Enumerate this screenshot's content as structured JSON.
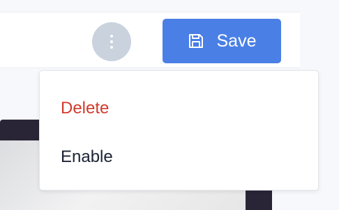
{
  "toolbar": {
    "more_icon": "more-vertical-icon",
    "save_icon": "floppy-disk-icon",
    "save_label": "Save"
  },
  "menu": {
    "items": [
      {
        "label": "Delete",
        "color": "#d23b2c"
      },
      {
        "label": "Enable",
        "color": "#1c2233"
      }
    ]
  },
  "colors": {
    "primary": "#4a7fe5",
    "more_button_bg": "#c9d2dd",
    "danger": "#d23b2c"
  }
}
